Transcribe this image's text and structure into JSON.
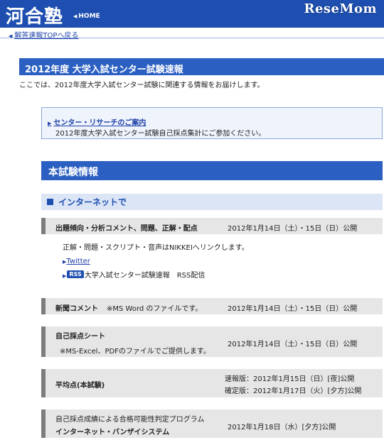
{
  "header": {
    "logo_text": "河合塾",
    "home_label": "HOME",
    "brand_text": "ReseMom",
    "bar_color": "#1e4fb0"
  },
  "nav": {
    "back_label": "解答速報TOPへ戻る"
  },
  "page": {
    "title": "2012年度 大学入試センター試験速報",
    "intro": "ここでは、2012年度大学入試センター試験に関連する情報をお届けします。"
  },
  "notice": {
    "link_label": "センター・リサーチのご案内",
    "text": "2012年度大学入試センター試験自己採点集計にご参加ください。"
  },
  "section": {
    "title": "本試験情報",
    "subsection": "インターネットで"
  },
  "rows": [
    {
      "label": "出題傾向・分析コメント、問題、正解・配点",
      "date": "2012年1月14日（土）・15日（日）公開",
      "detail": "正解・問題・スクリプト・音声はNIKKEIへリンクします。",
      "twitter_label": "Twitter",
      "rss_badge": "RSS",
      "rss_text": "大学入試センター試験速報　RSS配信"
    },
    {
      "label": "新聞コメント",
      "note": "※MS Word のファイルです。",
      "date": "2012年1月14日（土）・15日（日）公開"
    },
    {
      "label": "自己採点シート",
      "note": "※MS-Excel、PDFのファイルでご提供します。",
      "date": "2012年1月14日（土）・15日（日）公開"
    },
    {
      "label": "平均点(本試験)",
      "date_1": "速報版：2012年1月15日（日）[夜]公開",
      "date_2": "確定版：2012年1月17日（火）[夕方]公開"
    },
    {
      "label_top": "自己採点成績による合格可能性判定プログラム",
      "label": "インターネット・バンザイシステム",
      "date": "2012年1月18日（水）[夕方]公開"
    }
  ]
}
